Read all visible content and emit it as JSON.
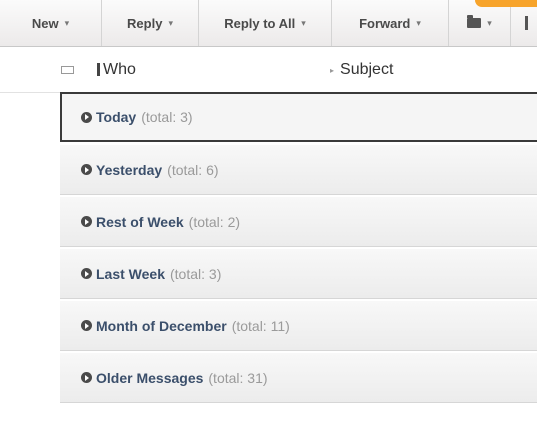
{
  "toolbar": {
    "new_label": "New",
    "reply_label": "Reply",
    "reply_all_label": "Reply to All",
    "forward_label": "Forward",
    "caret": "▾",
    "folder_icon": "folder-icon"
  },
  "columns": {
    "who": "Who",
    "subject": "Subject",
    "sort_indicator": "▸"
  },
  "groups": [
    {
      "label": "Today",
      "total": "(total: 3)",
      "selected": true
    },
    {
      "label": "Yesterday",
      "total": "(total: 6)"
    },
    {
      "label": "Rest of Week",
      "total": "(total: 2)"
    },
    {
      "label": "Last Week",
      "total": "(total: 3)"
    },
    {
      "label": "Month of December",
      "total": "(total: 11)"
    },
    {
      "label": "Older Messages",
      "total": "(total: 31)"
    }
  ],
  "colors": {
    "accent_orange": "#f7a42b",
    "group_label": "#3b4f6b",
    "total_text": "#9a9a9a"
  }
}
